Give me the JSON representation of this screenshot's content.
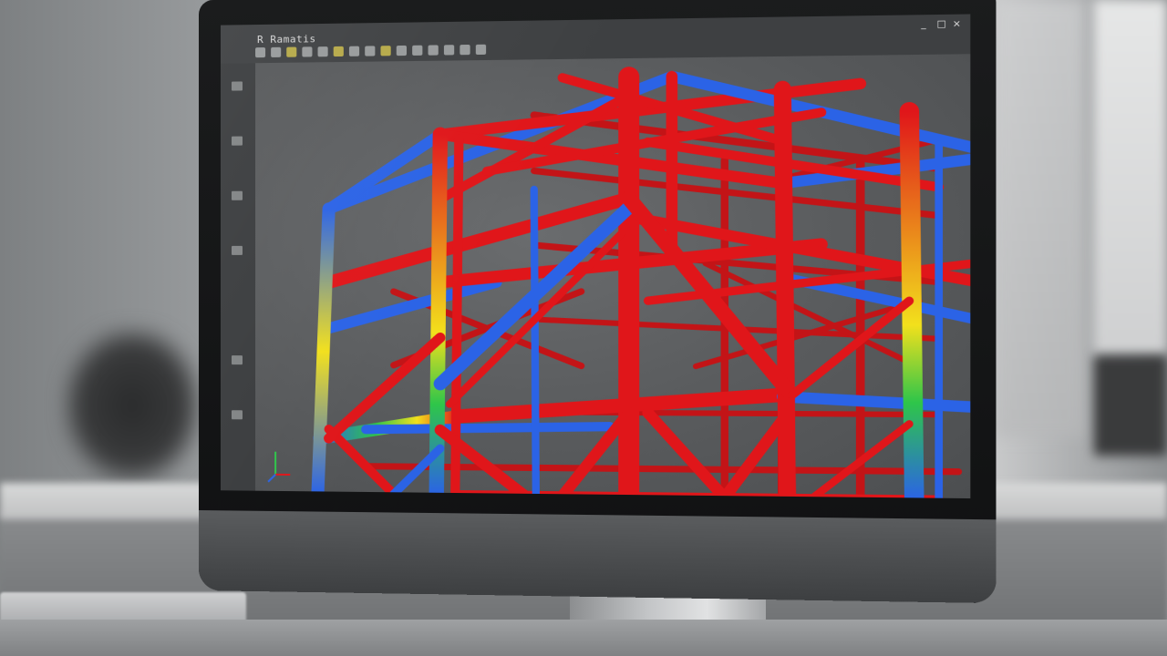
{
  "app": {
    "toolbar_label": "R Ramatis"
  },
  "window_controls": [
    "_",
    "□",
    "×"
  ],
  "icons": {
    "toolbar": [
      "select-icon",
      "move-icon",
      "rotate-icon",
      "zoom-icon",
      "pan-icon",
      "snap-icon",
      "grid-icon",
      "layer-icon",
      "node-icon",
      "member-icon",
      "load-icon",
      "analysis-icon",
      "results-icon",
      "section-icon",
      "view-icon"
    ],
    "left_panel": [
      "tree-icon",
      "properties-icon",
      "materials-icon",
      "loads-icon",
      "supports-icon",
      "results-icon"
    ],
    "axes": "xyz-axis-icon"
  },
  "colors": {
    "high_stress": "#e0161a",
    "low_stress": "#2b63e6",
    "mid_stress": "#f2e01c",
    "transition": "#2ec54a"
  }
}
